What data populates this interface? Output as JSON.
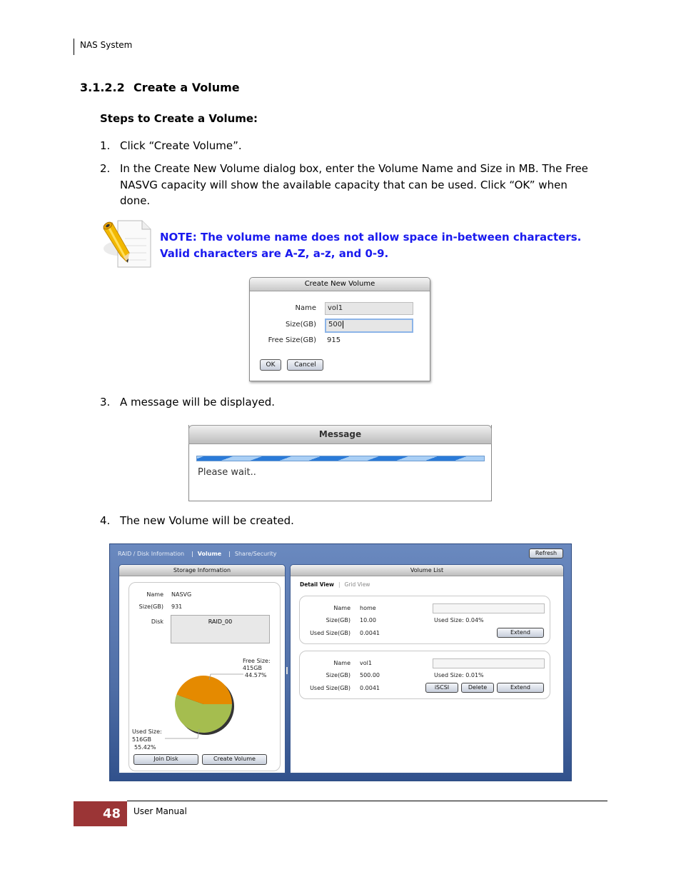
{
  "header": {
    "running_title": "NAS System"
  },
  "section": {
    "number": "3.1.2.2",
    "title": "Create a Volume"
  },
  "subheading": "Steps to Create a Volume:",
  "steps": [
    {
      "num": "1.",
      "text": "Click “Create Volume”."
    },
    {
      "num": "2.",
      "text": "In the Create New Volume dialog box, enter the Volume Name and Size in MB. The Free NASVG capacity will show the available capacity that can be used. Click “OK” when done."
    },
    {
      "num": "3.",
      "text": "A message will be displayed."
    },
    {
      "num": "4.",
      "text": "The new Volume will be created."
    }
  ],
  "note": {
    "icon": "note-pencil-icon",
    "line1": "NOTE: The volume name does not allow space in-between characters.",
    "line2": "Valid characters are A-Z, a-z, and 0-9."
  },
  "create_dialog": {
    "title": "Create New Volume",
    "name_label": "Name",
    "name_value": "vol1",
    "size_label": "Size(GB)",
    "size_value": "500",
    "free_label": "Free Size(GB)",
    "free_value": "915",
    "ok_label": "OK",
    "cancel_label": "Cancel"
  },
  "message_dialog": {
    "title": "Message",
    "text": "Please wait.."
  },
  "app": {
    "nav": {
      "tab1": "RAID / Disk Information",
      "tab2": "Volume",
      "tab3": "Share/Security",
      "sep": "|"
    },
    "refresh_label": "Refresh",
    "storage": {
      "title": "Storage Information",
      "name_label": "Name",
      "name_value": "NASVG",
      "size_label": "Size(GB)",
      "size_value": "931",
      "disk_label": "Disk",
      "disk_value": "RAID_00",
      "free_label": "Free Size:",
      "free_gb": "415GB",
      "free_pct": "44.57%",
      "used_label": "Used Size:",
      "used_gb": "516GB",
      "used_pct": "55.42%",
      "join_disk_label": "Join Disk",
      "create_volume_label": "Create Volume",
      "colors": {
        "free": "#e58a00",
        "used": "#a5bd4f"
      }
    },
    "volume_list": {
      "title": "Volume List",
      "detail_view": "Detail View",
      "grid_view": "Grid View",
      "sep": "|",
      "volumes": [
        {
          "name_label": "Name",
          "name": "home",
          "size_label": "Size(GB)",
          "size": "10.00",
          "used_label": "Used Size(GB)",
          "used": "0.0041",
          "used_pct_text": "Used Size: 0.04%",
          "used_fraction": 0.0004,
          "extend_label": "Extend"
        },
        {
          "name_label": "Name",
          "name": "vol1",
          "size_label": "Size(GB)",
          "size": "500.00",
          "used_label": "Used Size(GB)",
          "used": "0.0041",
          "used_pct_text": "Used Size: 0.01%",
          "used_fraction": 0.0001,
          "iscsi_label": "iSCSI",
          "delete_label": "Delete",
          "extend_label": "Extend"
        }
      ]
    }
  },
  "footer": {
    "page_number": "48",
    "text": "User Manual"
  }
}
